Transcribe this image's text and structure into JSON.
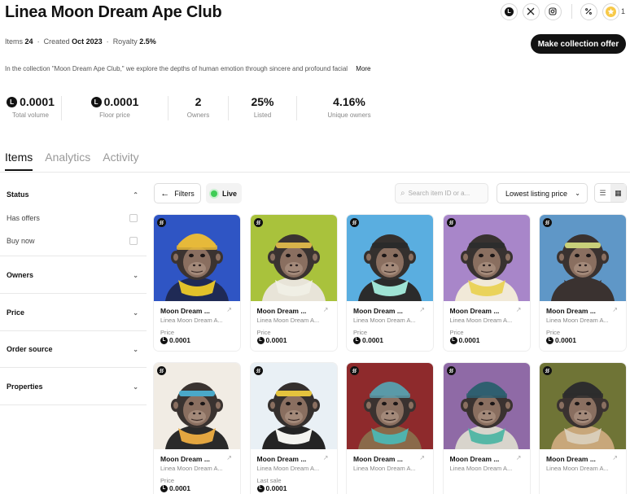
{
  "collection": {
    "title": "Linea Moon Dream Ape Club",
    "items_label": "Items",
    "items_value": "24",
    "created_label": "Created",
    "created_value": "Oct 2023",
    "royalty_label": "Royalty",
    "royalty_value": "2.5%",
    "description": "In the collection \"Moon Dream Ape Club,\" we explore the depths of human emotion through sincere and profound facial",
    "more_label": "More",
    "offer_button": "Make collection offer",
    "star_count": "1"
  },
  "header_icons": [
    "linea-icon",
    "x-twitter-icon",
    "instagram-icon",
    "percent-icon",
    "star-icon"
  ],
  "stats": [
    {
      "value": "0.0001",
      "label": "Total volume",
      "coin": true
    },
    {
      "value": "0.0001",
      "label": "Floor price",
      "coin": true
    },
    {
      "value": "2",
      "label": "Owners",
      "coin": false
    },
    {
      "value": "25%",
      "label": "Listed",
      "coin": false
    },
    {
      "value": "4.16%",
      "label": "Unique owners",
      "coin": false
    }
  ],
  "tabs": [
    "Items",
    "Analytics",
    "Activity"
  ],
  "active_tab": "Items",
  "sidebar": {
    "status": {
      "title": "Status",
      "options": [
        "Has offers",
        "Buy now"
      ]
    },
    "sections": [
      "Owners",
      "Price",
      "Order source",
      "Properties"
    ]
  },
  "toolbar": {
    "filters": "Filters",
    "live": "Live",
    "search_placeholder": "Search item ID or a...",
    "sort": "Lowest listing price"
  },
  "coin_letter": "L",
  "items": [
    {
      "name": "Moon Dream ...",
      "collection": "Linea Moon Dream A...",
      "price_label": "Price",
      "price": "0.0001",
      "bg": "#2f55c4",
      "fur": "#3b3330",
      "band": "#e6b93a",
      "scarf": "#e2c12a",
      "shirt": "#1f2a55",
      "hat": true
    },
    {
      "name": "Moon Dream ...",
      "collection": "Linea Moon Dream A...",
      "price_label": "Price",
      "price": "0.0001",
      "bg": "#a9c23c",
      "fur": "#3a3331",
      "band": "#d8b24a",
      "scarf": "#f0efe5",
      "shirt": "#e8e4d8",
      "hat": false
    },
    {
      "name": "Moon Dream ...",
      "collection": "Linea Moon Dream A...",
      "price_label": "Price",
      "price": "0.0001",
      "bg": "#5aaee0",
      "fur": "#34302e",
      "band": "#2a2a2a",
      "scarf": "#9fe3d4",
      "shirt": "#2b2b2b",
      "hat": false
    },
    {
      "name": "Moon Dream ...",
      "collection": "Linea Moon Dream A...",
      "price_label": "Price",
      "price": "0.0001",
      "bg": "#a886c9",
      "fur": "#383230",
      "band": "#2d2d2d",
      "scarf": "#ead35b",
      "shirt": "#f1e9d8",
      "hat": false
    },
    {
      "name": "Moon Dream ...",
      "collection": "Linea Moon Dream A...",
      "price_label": "Price",
      "price": "0.0001",
      "bg": "#5f97c7",
      "fur": "#3a3230",
      "band": "#c9d07a",
      "scarf": "#3a3230",
      "shirt": "#3a3230",
      "hat": false
    },
    {
      "name": "Moon Dream ...",
      "collection": "Linea Moon Dream A...",
      "price_label": "Price",
      "price": "0.0001",
      "bg": "#f1ece4",
      "fur": "#3a3330",
      "band": "#4aa8c8",
      "scarf": "#e3a640",
      "shirt": "#2a2a2a",
      "hat": false
    },
    {
      "name": "Moon Dream ...",
      "collection": "Linea Moon Dream A...",
      "price_label": "Last sale",
      "price": "0.0001",
      "bg": "#e9f0f5",
      "fur": "#35302e",
      "band": "#e4c33d",
      "scarf": "#f4f4f0",
      "shirt": "#242424",
      "hat": false
    },
    {
      "name": "Moon Dream ...",
      "collection": "Linea Moon Dream A...",
      "price_label": "",
      "price": "",
      "bg": "#8e2a2c",
      "fur": "#3a3230",
      "band": "#5a9aa8",
      "scarf": "#4fb3ae",
      "shirt": "#8a6a4a",
      "hat": true
    },
    {
      "name": "Moon Dream ...",
      "collection": "Linea Moon Dream A...",
      "price_label": "",
      "price": "",
      "bg": "#8f6aa6",
      "fur": "#3a3230",
      "band": "#2f5f70",
      "scarf": "#56b7a6",
      "shirt": "#d8d4cc",
      "hat": true
    },
    {
      "name": "Moon Dream ...",
      "collection": "Linea Moon Dream A...",
      "price_label": "",
      "price": "",
      "bg": "#6f7436",
      "fur": "#3a3230",
      "band": "#2d2d2d",
      "scarf": "#d9cdb8",
      "shirt": "#c8a77a",
      "hat": true
    }
  ]
}
